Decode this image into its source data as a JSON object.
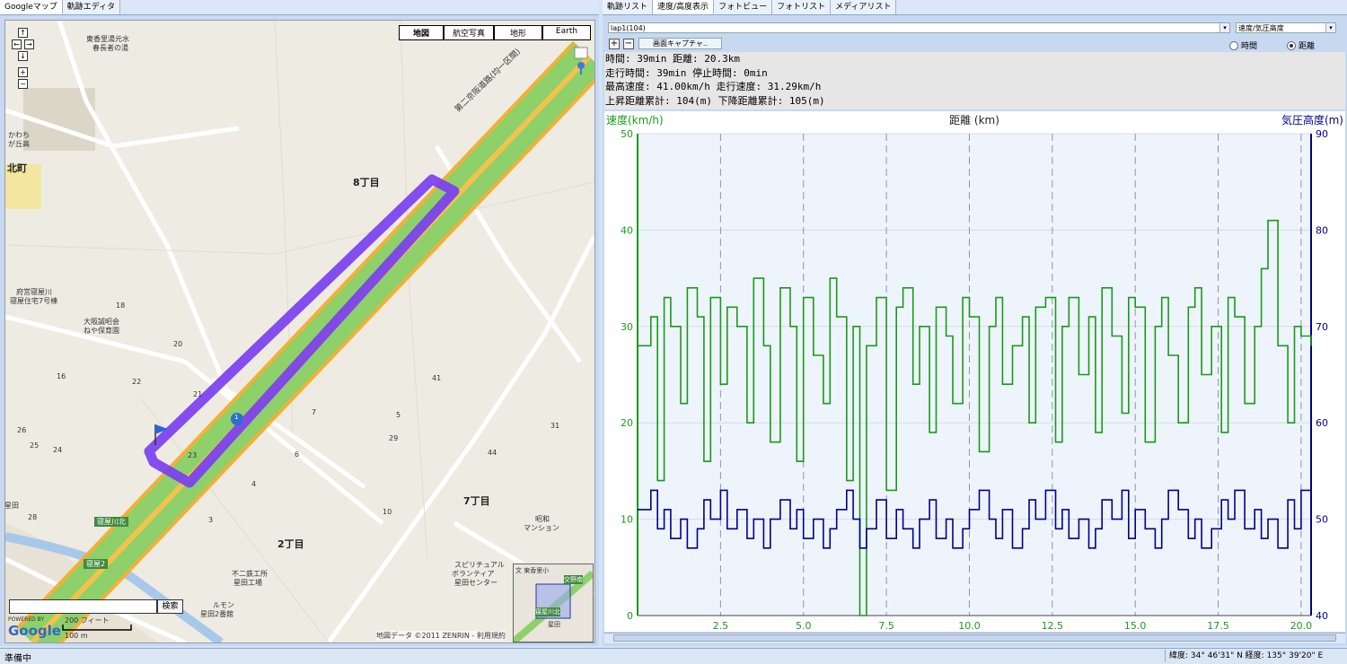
{
  "left_tabs": [
    {
      "label": "Googleマップ"
    },
    {
      "label": "軌跡エディタ"
    }
  ],
  "right_tabs": [
    {
      "label": "軌跡リスト"
    },
    {
      "label": "速度/高度表示"
    },
    {
      "label": "フォトビュー"
    },
    {
      "label": "フォトリスト"
    },
    {
      "label": "メディアリスト"
    }
  ],
  "map": {
    "types": [
      {
        "label": "地図"
      },
      {
        "label": "航空写真"
      },
      {
        "label": "地形"
      },
      {
        "label": "Earth"
      }
    ],
    "search_button": "検索",
    "search_value": "",
    "scale_feet": "200 フィート",
    "scale_m": "100 m",
    "copyright": "地図データ ©2011 ZENRIN - 利用規約",
    "google_logo": "Google",
    "powered_by": "POWERED BY",
    "road_name": "第二京阪道路(均一区間)",
    "route_marker": "1",
    "labels": [
      {
        "text": "東香里湯元水"
      },
      {
        "text": "春長者の湯"
      },
      {
        "text": "8丁目"
      },
      {
        "text": "7丁目"
      },
      {
        "text": "2丁目"
      },
      {
        "text": "府営寝屋川"
      },
      {
        "text": "寝屋住宅7号棟"
      },
      {
        "text": "大阪誠昭会"
      },
      {
        "text": "ねや保育園"
      },
      {
        "text": "寝屋川北"
      },
      {
        "text": "寝屋2"
      },
      {
        "text": "不二鉄工所"
      },
      {
        "text": "星田工場"
      },
      {
        "text": "ルモン"
      },
      {
        "text": "星田2番館"
      },
      {
        "text": "昭和"
      },
      {
        "text": "マンション"
      },
      {
        "text": "スピリチュアル"
      },
      {
        "text": "ボランティア"
      },
      {
        "text": "星田センター"
      },
      {
        "text": "かわち"
      },
      {
        "text": "が丘高"
      },
      {
        "text": "北町"
      },
      {
        "text": "18"
      },
      {
        "text": "20"
      },
      {
        "text": "16"
      },
      {
        "text": "22"
      },
      {
        "text": "21"
      },
      {
        "text": "26"
      },
      {
        "text": "25"
      },
      {
        "text": "24"
      },
      {
        "text": "23"
      },
      {
        "text": "6"
      },
      {
        "text": "7"
      },
      {
        "text": "5"
      },
      {
        "text": "41"
      },
      {
        "text": "44"
      },
      {
        "text": "31"
      },
      {
        "text": "29"
      },
      {
        "text": "4"
      },
      {
        "text": "3"
      },
      {
        "text": "10"
      },
      {
        "text": "28"
      },
      {
        "text": "星田"
      }
    ],
    "minimap_labels": [
      {
        "text": "文 東香里小"
      },
      {
        "text": "交野南"
      },
      {
        "text": "寝屋川北"
      },
      {
        "text": "星田"
      }
    ]
  },
  "lap_select": "lap1(104)",
  "mode_select": "速度/気圧高度",
  "radio_time": "時間",
  "radio_distance": "距離",
  "capture_button": "画面キャプチャ..",
  "zoom_in": "+",
  "zoom_out": "−",
  "stats": [
    "時間: 39min 距離: 20.3km",
    "走行時間: 39min 停止時間: 0min",
    "最高速度: 41.00km/h 走行速度: 31.29km/h",
    "上昇距離累計: 104(m) 下降距離累計: 105(m)"
  ],
  "chart_data": {
    "type": "line",
    "title": "",
    "xlabel": "距離 (km)",
    "ylabel_left": "速度(km/h)",
    "ylabel_right": "気圧高度(m)",
    "xlim": [
      0,
      20.3
    ],
    "ylim_left": [
      0,
      50
    ],
    "ylim_right": [
      40,
      90
    ],
    "x_ticks": [
      2.5,
      5.0,
      7.5,
      10.0,
      12.5,
      15.0,
      17.5,
      20.0
    ],
    "y_ticks_left": [
      0,
      10,
      20,
      30,
      40,
      50
    ],
    "y_ticks_right": [
      40,
      50,
      60,
      70,
      80,
      90
    ],
    "grid": true,
    "series": [
      {
        "name": "速度(km/h)",
        "axis": "left",
        "color": "#1a9a1a",
        "x": [
          0,
          0.4,
          0.6,
          0.8,
          1.0,
          1.3,
          1.5,
          1.8,
          2.0,
          2.2,
          2.5,
          2.7,
          3.0,
          3.3,
          3.5,
          3.8,
          4.0,
          4.3,
          4.6,
          4.8,
          5.0,
          5.3,
          5.6,
          5.8,
          6.0,
          6.3,
          6.5,
          6.7,
          6.9,
          7.2,
          7.5,
          7.8,
          8.0,
          8.3,
          8.5,
          8.8,
          9.0,
          9.3,
          9.5,
          9.8,
          10.0,
          10.3,
          10.6,
          10.8,
          11.0,
          11.3,
          11.6,
          11.8,
          12.0,
          12.3,
          12.6,
          12.8,
          13.0,
          13.3,
          13.6,
          13.8,
          14.0,
          14.3,
          14.6,
          14.8,
          15.0,
          15.3,
          15.6,
          15.8,
          16.0,
          16.3,
          16.6,
          16.8,
          17.0,
          17.3,
          17.6,
          17.8,
          18.0,
          18.3,
          18.6,
          18.8,
          19.0,
          19.3,
          19.6,
          19.8,
          20.0,
          20.3
        ],
        "values": [
          28,
          31,
          14,
          33,
          30,
          22,
          34,
          31,
          16,
          33,
          24,
          32,
          30,
          20,
          35,
          28,
          18,
          34,
          30,
          16,
          33,
          27,
          22,
          35,
          31,
          14,
          30,
          0,
          28,
          33,
          13,
          32,
          34,
          24,
          30,
          19,
          32,
          29,
          22,
          33,
          31,
          17,
          30,
          33,
          24,
          28,
          31,
          20,
          32,
          33,
          18,
          30,
          33,
          25,
          31,
          19,
          34,
          29,
          21,
          33,
          32,
          18,
          30,
          33,
          27,
          20,
          32,
          34,
          25,
          30,
          19,
          33,
          31,
          22,
          30,
          36,
          41,
          28,
          20,
          30,
          29,
          28
        ]
      },
      {
        "name": "気圧高度(m)",
        "axis": "right",
        "color": "#00008b",
        "x": [
          0,
          0.4,
          0.6,
          0.8,
          1.0,
          1.3,
          1.5,
          1.8,
          2.0,
          2.2,
          2.5,
          2.7,
          3.0,
          3.3,
          3.5,
          3.8,
          4.0,
          4.3,
          4.6,
          4.8,
          5.0,
          5.3,
          5.6,
          5.8,
          6.0,
          6.3,
          6.5,
          6.7,
          6.9,
          7.2,
          7.5,
          7.8,
          8.0,
          8.3,
          8.5,
          8.8,
          9.0,
          9.3,
          9.5,
          9.8,
          10.0,
          10.3,
          10.6,
          10.8,
          11.0,
          11.3,
          11.6,
          11.8,
          12.0,
          12.3,
          12.6,
          12.8,
          13.0,
          13.3,
          13.6,
          13.8,
          14.0,
          14.3,
          14.6,
          14.8,
          15.0,
          15.3,
          15.6,
          15.8,
          16.0,
          16.3,
          16.6,
          16.8,
          17.0,
          17.3,
          17.6,
          17.8,
          18.0,
          18.3,
          18.6,
          18.8,
          19.0,
          19.3,
          19.6,
          19.8,
          20.0,
          20.3
        ],
        "values": [
          51,
          53,
          49,
          51,
          48,
          50,
          47,
          49,
          52,
          50,
          53,
          49,
          51,
          48,
          50,
          47,
          50,
          52,
          49,
          51,
          48,
          50,
          47,
          49,
          51,
          53,
          50,
          47,
          49,
          52,
          48,
          51,
          49,
          47,
          50,
          52,
          48,
          50,
          47,
          49,
          51,
          53,
          50,
          48,
          51,
          47,
          49,
          52,
          50,
          53,
          49,
          51,
          48,
          50,
          47,
          49,
          52,
          50,
          53,
          48,
          51,
          49,
          47,
          50,
          53,
          51,
          48,
          50,
          47,
          49,
          52,
          50,
          53,
          49,
          51,
          48,
          50,
          47,
          52,
          49,
          53,
          54
        ]
      }
    ]
  },
  "status": "準備中",
  "coords": "緯度: 34° 46'31\" N  経度: 135° 39'20\" E"
}
